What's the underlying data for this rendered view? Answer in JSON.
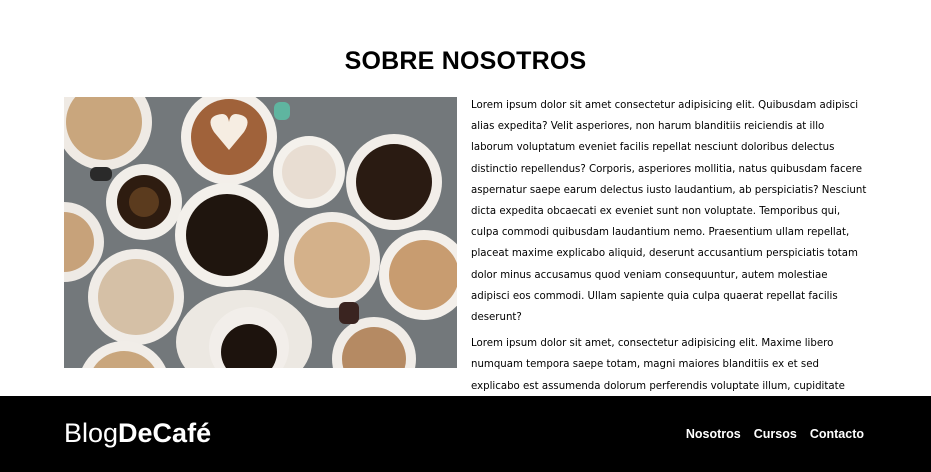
{
  "section": {
    "title": "SOBRE NOSOTROS",
    "image_alt": "coffee-cups-photo",
    "paragraphs": [
      "Lorem ipsum dolor sit amet consectetur adipisicing elit. Quibusdam adipisci alias expedita? Velit asperiores, non harum blanditiis reiciendis at illo laborum voluptatum eveniet facilis repellat nesciunt doloribus delectus distinctio repellendus? Corporis, asperiores mollitia, natus quibusdam facere aspernatur saepe earum delectus iusto laudantium, ab perspiciatis? Nesciunt dicta expedita obcaecati ex eveniet sunt non voluptate. Temporibus qui, culpa commodi quibusdam laudantium nemo. Praesentium ullam repellat, placeat maxime explicabo aliquid, deserunt accusantium perspiciatis totam dolor minus accusamus quod veniam consequuntur, autem molestiae adipisci eos commodi. Ullam sapiente quia culpa quaerat repellat facilis deserunt?",
      "Lorem ipsum dolor sit amet, consectetur adipisicing elit. Maxime libero numquam tempora saepe totam, magni maiores blanditiis ex et sed explicabo est assumenda dolorum perferendis voluptate illum, cupiditate eaque neque!"
    ]
  },
  "footer": {
    "logo_light": "Blog",
    "logo_bold": "DeCafé",
    "nav": [
      "Nosotros",
      "Cursos",
      "Contacto"
    ]
  },
  "colors": {
    "footer_bg": "#000000",
    "text": "#000000",
    "background": "#ffffff"
  }
}
